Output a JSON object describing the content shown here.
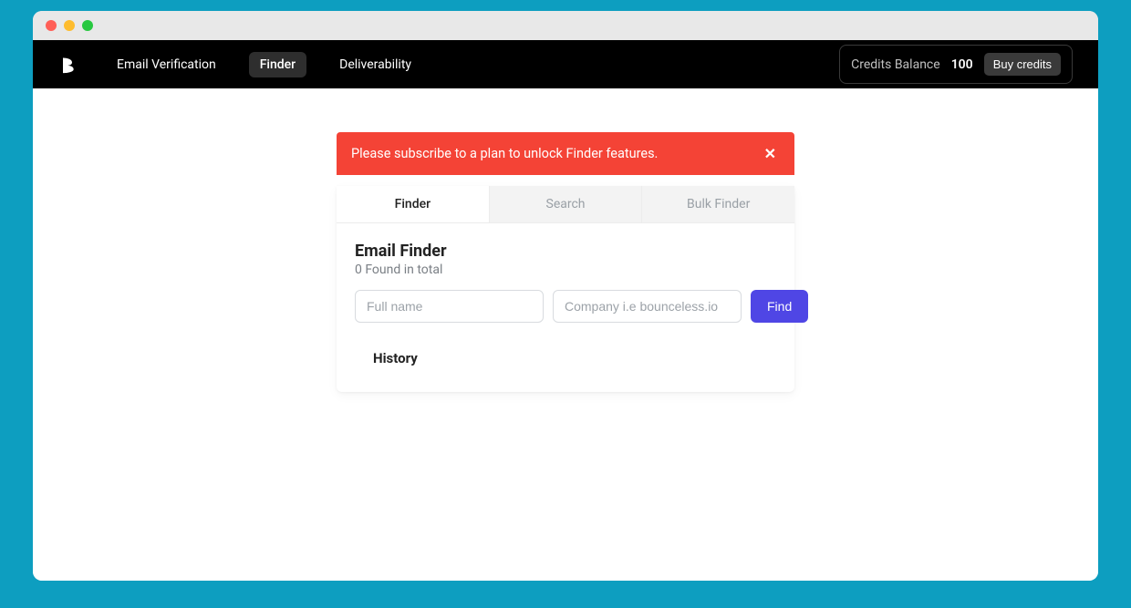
{
  "nav": {
    "items": [
      {
        "label": "Email Verification"
      },
      {
        "label": "Finder"
      },
      {
        "label": "Deliverability"
      }
    ],
    "active_index": 1
  },
  "credits": {
    "label": "Credits Balance",
    "amount": "100",
    "buy_label": "Buy credits"
  },
  "alert": {
    "message": "Please subscribe to a plan to unlock Finder features."
  },
  "tabs": {
    "items": [
      {
        "label": "Finder"
      },
      {
        "label": "Search"
      },
      {
        "label": "Bulk Finder"
      }
    ],
    "active_index": 0
  },
  "finder": {
    "title": "Email Finder",
    "subtitle": "0 Found in total",
    "name_placeholder": "Full name",
    "company_placeholder": "Company i.e bounceless.io",
    "find_label": "Find",
    "history_label": "History"
  }
}
